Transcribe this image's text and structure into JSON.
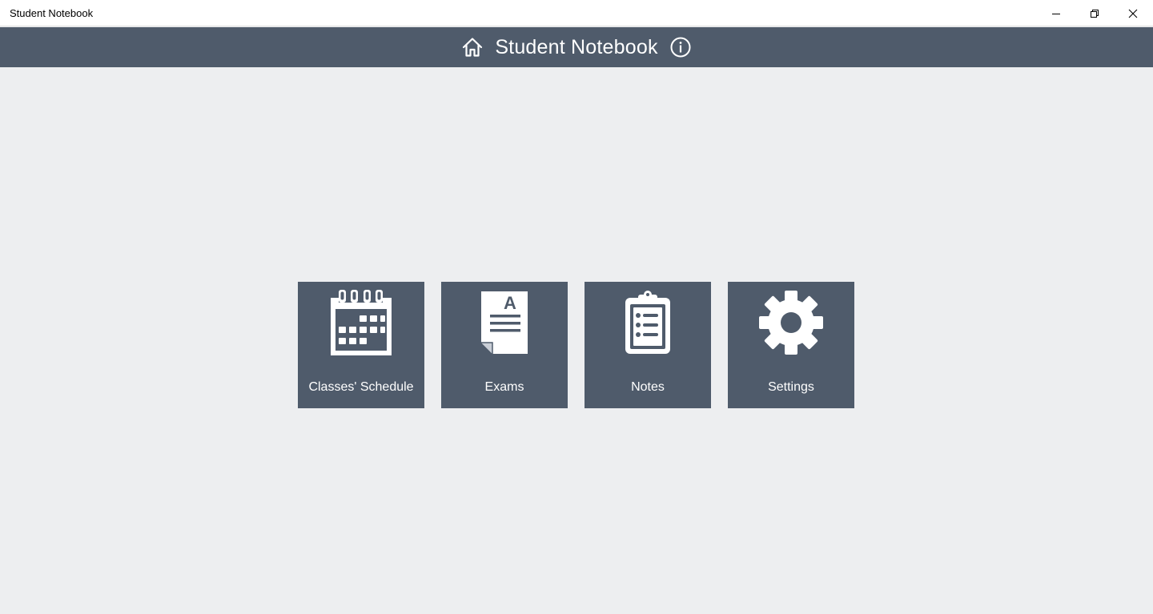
{
  "window": {
    "title": "Student Notebook",
    "controls": [
      "minimize-icon",
      "restore-icon",
      "close-icon"
    ]
  },
  "header": {
    "title": "Student Notebook",
    "left_icon": "home-icon",
    "right_icon": "info-icon",
    "background": "#4f5b6b"
  },
  "tiles": [
    {
      "label": "Classes' Schedule",
      "icon": "calendar-icon"
    },
    {
      "label": "Exams",
      "icon": "document-icon"
    },
    {
      "label": "Notes",
      "icon": "clipboard-icon"
    },
    {
      "label": "Settings",
      "icon": "gear-icon"
    }
  ],
  "colors": {
    "accent": "#4f5b6b",
    "background": "#edeef0",
    "tile_text": "#ffffff"
  }
}
